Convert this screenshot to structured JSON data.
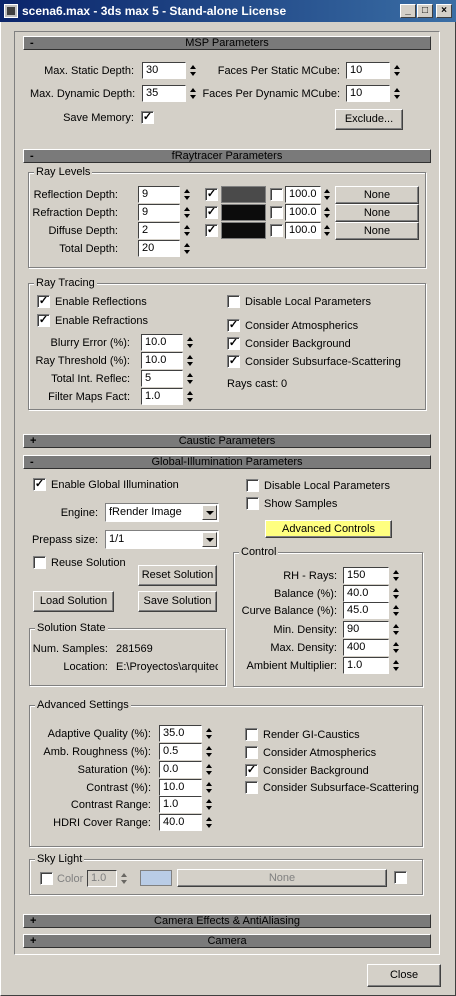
{
  "window": {
    "title": "scena6.max - 3ds max 5 - Stand-alone License",
    "min_label": "_",
    "max_label": "□",
    "close_label": "×"
  },
  "msp": {
    "title": "MSP Parameters",
    "toggle": "-",
    "max_static_depth_label": "Max. Static Depth:",
    "max_static_depth": "30",
    "max_dynamic_depth_label": "Max. Dynamic Depth:",
    "max_dynamic_depth": "35",
    "faces_static_label": "Faces Per Static MCube:",
    "faces_static": "10",
    "faces_dynamic_label": "Faces Per Dynamic MCube:",
    "faces_dynamic": "10",
    "save_memory_label": "Save Memory:",
    "save_memory_checked": "✓",
    "exclude_label": "Exclude..."
  },
  "raytracer": {
    "title": "fRaytracer Parameters",
    "toggle": "-",
    "ray_levels": {
      "group_label": "Ray Levels",
      "rows": [
        {
          "label": "Reflection Depth:",
          "value": "9",
          "enabled": "✓",
          "color": "#4a4a4a",
          "amount_checked": "",
          "amount": "100.0",
          "map": "None"
        },
        {
          "label": "Refraction Depth:",
          "value": "9",
          "enabled": "✓",
          "color": "#0c0c0c",
          "amount_checked": "",
          "amount": "100.0",
          "map": "None"
        },
        {
          "label": "Diffuse Depth:",
          "value": "2",
          "enabled": "✓",
          "color": "#0c0c0c",
          "amount_checked": "",
          "amount": "100.0",
          "map": "None"
        }
      ],
      "total_depth_label": "Total Depth:",
      "total_depth": "20"
    },
    "ray_tracing": {
      "group_label": "Ray Tracing",
      "enable_reflections": "Enable Reflections",
      "enable_reflections_checked": "✓",
      "enable_refractions": "Enable Refractions",
      "enable_refractions_checked": "✓",
      "disable_local": "Disable Local Parameters",
      "disable_local_checked": "",
      "consider_atmospherics": "Consider Atmospherics",
      "consider_atmospherics_checked": "✓",
      "consider_background": "Consider Background",
      "consider_background_checked": "✓",
      "consider_sss": "Consider Subsurface-Scattering",
      "consider_sss_checked": "✓",
      "blurry_error_label": "Blurry Error (%):",
      "blurry_error": "10.0",
      "ray_threshold_label": "Ray Threshold (%):",
      "ray_threshold": "10.0",
      "total_int_reflec_label": "Total Int. Reflec:",
      "total_int_reflec": "5",
      "filter_maps_label": "Filter Maps Fact:",
      "filter_maps": "1.0",
      "rays_cast_label": "Rays cast:",
      "rays_cast": "0"
    }
  },
  "caustic": {
    "title": "Caustic Parameters",
    "toggle": "+"
  },
  "gi": {
    "title": "Global-Illumination Parameters",
    "toggle": "-",
    "enable_gi": "Enable Global Illumination",
    "enable_gi_checked": "✓",
    "disable_local": "Disable Local Parameters",
    "disable_local_checked": "",
    "show_samples": "Show Samples",
    "show_samples_checked": "",
    "advanced_controls": "Advanced Controls",
    "advanced_controls_color": "#ffff80",
    "engine_label": "Engine:",
    "engine": "fRender Image",
    "prepass_label": "Prepass size:",
    "prepass": "1/1",
    "reuse_solution": "Reuse Solution",
    "reuse_solution_checked": "",
    "reset_solution": "Reset Solution",
    "load_solution": "Load Solution",
    "save_solution": "Save Solution",
    "solution_state": {
      "group_label": "Solution State",
      "num_samples_label": "Num. Samples:",
      "num_samples": "281569",
      "location_label": "Location:",
      "location": "E:\\Proyectos\\arquitec"
    },
    "control": {
      "group_label": "Control",
      "rows": [
        {
          "label": "RH - Rays:",
          "value": "150"
        },
        {
          "label": "Balance (%):",
          "value": "40.0"
        },
        {
          "label": "Curve Balance (%):",
          "value": "45.0"
        },
        {
          "label": "Min. Density:",
          "value": "90"
        },
        {
          "label": "Max. Density:",
          "value": "400"
        },
        {
          "label": "Ambient Multiplier:",
          "value": "1.0"
        }
      ]
    },
    "advanced": {
      "group_label": "Advanced Settings",
      "rows": [
        {
          "label": "Adaptive Quality (%):",
          "value": "35.0"
        },
        {
          "label": "Amb. Roughness (%):",
          "value": "0.5"
        },
        {
          "label": "Saturation (%):",
          "value": "0.0"
        },
        {
          "label": "Contrast (%):",
          "value": "10.0"
        },
        {
          "label": "Contrast Range:",
          "value": "1.0"
        },
        {
          "label": "HDRI Cover Range:",
          "value": "40.0"
        }
      ],
      "checks": [
        {
          "label": "Render GI-Caustics",
          "checked": ""
        },
        {
          "label": "Consider Atmospherics",
          "checked": ""
        },
        {
          "label": "Consider Background",
          "checked": "✓"
        },
        {
          "label": "Consider Subsurface-Scattering",
          "checked": ""
        }
      ]
    },
    "sky_light": {
      "group_label": "Sky Light",
      "color_label": "Color",
      "color_checked": "",
      "multiplier": "1.0",
      "swatch_color": "#b9cce6",
      "map": "None",
      "map_checked": ""
    }
  },
  "camera_effects": {
    "title": "Camera Effects & AntiAliasing",
    "toggle": "+"
  },
  "camera": {
    "title": "Camera",
    "toggle": "+"
  },
  "footer": {
    "close_label": "Close"
  }
}
